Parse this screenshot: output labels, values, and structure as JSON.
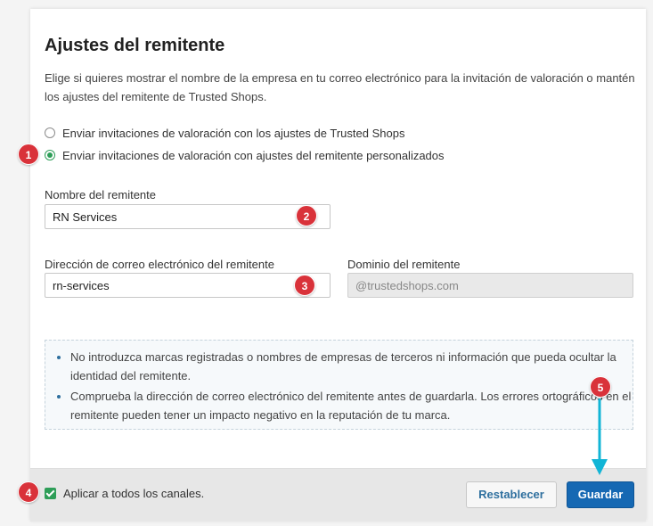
{
  "settings": {
    "title": "Ajustes del remitente",
    "description": "Elige si quieres mostrar el nombre de la empresa en tu correo electrónico para la invitación de valoración o mantén los ajustes del remitente de Trusted Shops.",
    "options": [
      {
        "label": "Enviar invitaciones de valoración con los ajustes de Trusted Shops",
        "checked": false
      },
      {
        "label": "Enviar invitaciones de valoración con ajustes del remitente personalizados",
        "checked": true
      }
    ],
    "sender_name": {
      "label": "Nombre del remitente",
      "value": "RN Services"
    },
    "sender_email": {
      "label": "Dirección de correo electrónico del remitente",
      "value": "rn-services"
    },
    "sender_domain": {
      "label": "Dominio del remitente",
      "value": "@trustedshops.com"
    },
    "notice": [
      "No introduzca marcas registradas o nombres de empresas de terceros ni información que pueda ocultar la identidad del remitente.",
      "Comprueba la dirección de correo electrónico del remitente antes de guardarla. Los errores ortográficos en el remitente pueden tener un impacto negativo en la reputación de tu marca."
    ]
  },
  "footer": {
    "apply_all_label": "Aplicar a todos los canales.",
    "apply_all_checked": true,
    "reset_label": "Restablecer",
    "save_label": "Guardar"
  },
  "markers": [
    "1",
    "2",
    "3",
    "4",
    "5"
  ],
  "colors": {
    "accent": "#2e9e58",
    "primary": "#1568b3",
    "marker": "#d9323a",
    "arrow": "#12b5d6"
  }
}
